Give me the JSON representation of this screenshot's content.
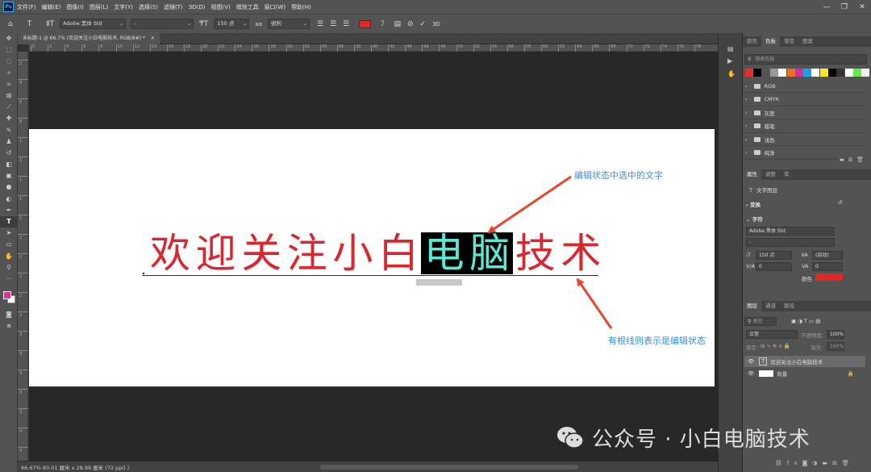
{
  "menubar": {
    "logo": "Ps",
    "items": [
      "文件(F)",
      "编辑(E)",
      "图像(I)",
      "图层(L)",
      "文字(Y)",
      "选择(S)",
      "滤镜(T)",
      "3D(D)",
      "视图(V)",
      "增效工具",
      "窗口(W)",
      "帮助(H)"
    ]
  },
  "options": {
    "font_family": "Adobe 黑体 Std",
    "font_style": "-",
    "font_size": "150 点",
    "antialias": "锐利",
    "text_color": "#e02727"
  },
  "document": {
    "tab_title": "未标题-1 @ 66.7% (欢迎关注小白电脑技术, RGB/8#) *"
  },
  "ruler": {
    "h": [
      "0",
      "2",
      "4",
      "6",
      "8",
      "10",
      "12",
      "14",
      "16",
      "18",
      "20",
      "22",
      "24",
      "26",
      "28",
      "30",
      "32",
      "34",
      "36",
      "38",
      "40",
      "42",
      "44",
      "46",
      "48",
      "50",
      "52",
      "54",
      "56",
      "58",
      "60",
      "62",
      "64",
      "66",
      "68",
      "70",
      "72",
      "74",
      "76",
      "78"
    ],
    "v": [
      "2",
      "4",
      "6",
      "8",
      "1",
      "1",
      "1",
      "1",
      "1",
      "2",
      "2",
      "2",
      "2",
      "2",
      "3",
      "3",
      "3",
      "3",
      "3",
      "4",
      "4"
    ]
  },
  "canvas": {
    "text_chars": [
      "欢",
      "迎",
      "关",
      "注",
      "小",
      "白",
      "电",
      "脑",
      "技",
      "术"
    ],
    "highlight_indices": [
      6,
      7
    ],
    "annotation_top": "编辑状态中选中的文字",
    "annotation_bottom": "有根线则表示是编辑状态"
  },
  "status": {
    "text": "66.67%  80.01 厘米 x 29.99 厘米 (72 ppi)  〉"
  },
  "swatches_panel": {
    "tabs": [
      "颜色",
      "色板",
      "渐变",
      "图案"
    ],
    "search_placeholder": "搜索色板",
    "colors": [
      "#e62e2e",
      "#000000",
      "#555555",
      "#999999",
      "#ffffff",
      "#e8731a",
      "#d62f95",
      "#1aa3e8",
      "#ffffff",
      "#ffe61a",
      "#000000",
      "#333333",
      "#ffffff",
      "#66e84a",
      "#eeeeee"
    ],
    "groups": [
      "RGB",
      "CMYK",
      "灰度",
      "蜡笔",
      "浅色",
      "纯净"
    ]
  },
  "properties_panel": {
    "tabs": [
      "属性",
      "调整",
      "库"
    ],
    "layer_type": "文字图层",
    "transform_label": "变换",
    "character_label": "字符",
    "font_family": "Adobe 黑体 Std",
    "font_style": "-",
    "font_size": "150 点",
    "leading": "(自动)",
    "tracking_left": "0",
    "tracking_right": "0",
    "color_label": "颜色",
    "color": "#e02727"
  },
  "layers_panel": {
    "tabs": [
      "图层",
      "通道",
      "路径"
    ],
    "search_placeholder": "类型",
    "blend_mode": "正常",
    "opacity_label": "不透明度:",
    "opacity": "100%",
    "lock_label": "锁定:",
    "fill_label": "填充:",
    "fill": "100%",
    "layers": [
      {
        "name": "欢迎关注小白电脑技术",
        "type": "text"
      },
      {
        "name": "背景",
        "type": "background"
      }
    ]
  },
  "watermark": {
    "text": "公众号 · 小白电脑技术"
  }
}
